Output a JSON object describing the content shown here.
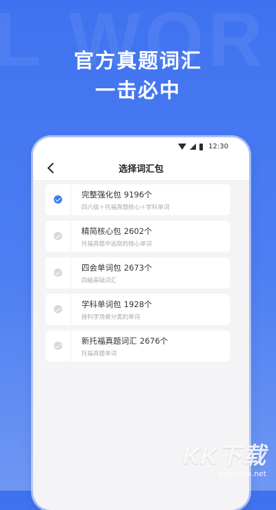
{
  "background": {
    "word": "L WOR",
    "accent": "#3f72f0"
  },
  "headline": {
    "line1": "官方真题词汇",
    "line2": "一击必中"
  },
  "status_bar": {
    "time": "12:30",
    "icons": [
      "wifi-icon",
      "signal-icon",
      "battery-icon"
    ]
  },
  "nav": {
    "back_icon": "chevron-left-icon",
    "title": "选择词汇包"
  },
  "list": [
    {
      "title": "完整强化包",
      "count": "9196个",
      "desc": "四六级＋托福真题核心＋学科单词",
      "selected": true
    },
    {
      "title": "精简核心包",
      "count": "2602个",
      "desc": "托福真题中选取的核心单词",
      "selected": false
    },
    {
      "title": "四会单词包",
      "count": "2673个",
      "desc": "四级基础词汇",
      "selected": false
    },
    {
      "title": "学科单词包",
      "count": "1928个",
      "desc": "按科学场景分类的单词",
      "selected": false
    },
    {
      "title": "新托福真题词汇",
      "count": "2676个",
      "desc": "托福真题单词",
      "selected": false
    }
  ],
  "colors": {
    "selected": "#3b7ff1",
    "unselected": "#d8d8dc"
  },
  "watermark": {
    "logo": "KK下载",
    "url": "www.kkx.net"
  }
}
